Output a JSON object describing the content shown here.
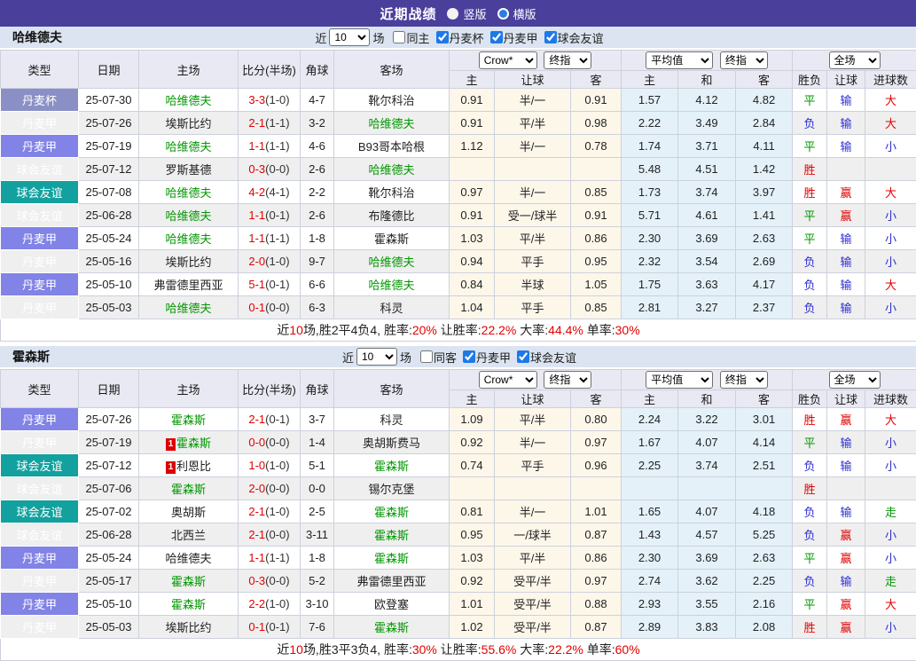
{
  "header": {
    "title": "近期战绩",
    "vertical_label": "竖版",
    "horizontal_label": "横版",
    "selected_layout": "横版"
  },
  "columns": {
    "type": "类型",
    "date": "日期",
    "home": "主场",
    "score": "比分(半场)",
    "corner": "角球",
    "away": "客场",
    "sub": [
      "主",
      "让球",
      "客",
      "主",
      "和",
      "客",
      "胜负",
      "让球",
      "进球数"
    ]
  },
  "controls": {
    "crow_select": "Crow*",
    "final_select": "终指",
    "avg_select": "平均值",
    "final_select_2": "终指",
    "scope_select": "全场"
  },
  "colors": {
    "titlebar": "#4b3f9c",
    "badge_cup": "#8a90c6",
    "badge_league": "#8183e6",
    "badge_friendly": "#12a19e",
    "odds_bg": "#fdf7ea",
    "avg_bg": "#e4f1f9",
    "win_red": "#e30000",
    "draw_green": "#009700",
    "lose_blue": "#2d2dd2"
  },
  "sections": [
    {
      "team": "哈维德夫",
      "filter": {
        "near_label": "近",
        "count": "10",
        "games_label": "场",
        "same": {
          "label": "同主",
          "checked": false
        },
        "leagues": [
          {
            "label": "丹麦杯",
            "checked": true
          },
          {
            "label": "丹麦甲",
            "checked": true
          },
          {
            "label": "球会友谊",
            "checked": true
          }
        ]
      },
      "rows": [
        {
          "league": "丹麦杯",
          "kind": "cup",
          "date": "25-07-30",
          "home": "哈维德夫",
          "home_green": true,
          "home_redcard": "",
          "score": "3-3",
          "half": "(1-0)",
          "corner": "4-7",
          "away": "靴尔科治",
          "away_green": false,
          "away_redcard": "",
          "odds": [
            "0.91",
            "半/一",
            "0.91"
          ],
          "avg": [
            "1.57",
            "4.12",
            "4.82"
          ],
          "results": [
            {
              "text": "平",
              "color": "green"
            },
            {
              "text": "输",
              "color": "blue"
            },
            {
              "text": "大",
              "color": "red"
            }
          ]
        },
        {
          "league": "丹麦甲",
          "kind": "league",
          "date": "25-07-26",
          "home": "埃斯比约",
          "home_green": false,
          "home_redcard": "",
          "score": "2-1",
          "half": "(1-1)",
          "corner": "3-2",
          "away": "哈维德夫",
          "away_green": true,
          "away_redcard": "",
          "odds": [
            "0.91",
            "平/半",
            "0.98"
          ],
          "avg": [
            "2.22",
            "3.49",
            "2.84"
          ],
          "results": [
            {
              "text": "负",
              "color": "blue"
            },
            {
              "text": "输",
              "color": "blue"
            },
            {
              "text": "大",
              "color": "red"
            }
          ]
        },
        {
          "league": "丹麦甲",
          "kind": "league",
          "date": "25-07-19",
          "home": "哈维德夫",
          "home_green": true,
          "home_redcard": "",
          "score": "1-1",
          "half": "(1-1)",
          "corner": "4-6",
          "away": "B93哥本哈根",
          "away_green": false,
          "away_redcard": "",
          "odds": [
            "1.12",
            "半/一",
            "0.78"
          ],
          "avg": [
            "1.74",
            "3.71",
            "4.11"
          ],
          "results": [
            {
              "text": "平",
              "color": "green"
            },
            {
              "text": "输",
              "color": "blue"
            },
            {
              "text": "小",
              "color": "blue"
            }
          ]
        },
        {
          "league": "球会友谊",
          "kind": "friendly",
          "date": "25-07-12",
          "home": "罗斯基德",
          "home_green": false,
          "home_redcard": "",
          "score": "0-3",
          "half": "(0-0)",
          "corner": "2-6",
          "away": "哈维德夫",
          "away_green": true,
          "away_redcard": "",
          "odds": [
            "",
            "",
            ""
          ],
          "avg": [
            "5.48",
            "4.51",
            "1.42"
          ],
          "results": [
            {
              "text": "胜",
              "color": "red"
            },
            {
              "text": "",
              "color": ""
            },
            {
              "text": "",
              "color": ""
            }
          ]
        },
        {
          "league": "球会友谊",
          "kind": "friendly",
          "date": "25-07-08",
          "home": "哈维德夫",
          "home_green": true,
          "home_redcard": "",
          "score": "4-2",
          "half": "(4-1)",
          "corner": "2-2",
          "away": "靴尔科治",
          "away_green": false,
          "away_redcard": "",
          "odds": [
            "0.97",
            "半/一",
            "0.85"
          ],
          "avg": [
            "1.73",
            "3.74",
            "3.97"
          ],
          "results": [
            {
              "text": "胜",
              "color": "red"
            },
            {
              "text": "赢",
              "color": "red"
            },
            {
              "text": "大",
              "color": "red"
            }
          ]
        },
        {
          "league": "球会友谊",
          "kind": "friendly",
          "date": "25-06-28",
          "home": "哈维德夫",
          "home_green": true,
          "home_redcard": "",
          "score": "1-1",
          "half": "(0-1)",
          "corner": "2-6",
          "away": "布隆德比",
          "away_green": false,
          "away_redcard": "",
          "odds": [
            "0.91",
            "受一/球半",
            "0.91"
          ],
          "avg": [
            "5.71",
            "4.61",
            "1.41"
          ],
          "results": [
            {
              "text": "平",
              "color": "green"
            },
            {
              "text": "赢",
              "color": "red"
            },
            {
              "text": "小",
              "color": "blue"
            }
          ]
        },
        {
          "league": "丹麦甲",
          "kind": "league",
          "date": "25-05-24",
          "home": "哈维德夫",
          "home_green": true,
          "home_redcard": "",
          "score": "1-1",
          "half": "(1-1)",
          "corner": "1-8",
          "away": "霍森斯",
          "away_green": false,
          "away_redcard": "",
          "odds": [
            "1.03",
            "平/半",
            "0.86"
          ],
          "avg": [
            "2.30",
            "3.69",
            "2.63"
          ],
          "results": [
            {
              "text": "平",
              "color": "green"
            },
            {
              "text": "输",
              "color": "blue"
            },
            {
              "text": "小",
              "color": "blue"
            }
          ]
        },
        {
          "league": "丹麦甲",
          "kind": "league",
          "date": "25-05-16",
          "home": "埃斯比约",
          "home_green": false,
          "home_redcard": "",
          "score": "2-0",
          "half": "(1-0)",
          "corner": "9-7",
          "away": "哈维德夫",
          "away_green": true,
          "away_redcard": "",
          "odds": [
            "0.94",
            "平手",
            "0.95"
          ],
          "avg": [
            "2.32",
            "3.54",
            "2.69"
          ],
          "results": [
            {
              "text": "负",
              "color": "blue"
            },
            {
              "text": "输",
              "color": "blue"
            },
            {
              "text": "小",
              "color": "blue"
            }
          ]
        },
        {
          "league": "丹麦甲",
          "kind": "league",
          "date": "25-05-10",
          "home": "弗雷德里西亚",
          "home_green": false,
          "home_redcard": "",
          "score": "5-1",
          "half": "(0-1)",
          "corner": "6-6",
          "away": "哈维德夫",
          "away_green": true,
          "away_redcard": "",
          "odds": [
            "0.84",
            "半球",
            "1.05"
          ],
          "avg": [
            "1.75",
            "3.63",
            "4.17"
          ],
          "results": [
            {
              "text": "负",
              "color": "blue"
            },
            {
              "text": "输",
              "color": "blue"
            },
            {
              "text": "大",
              "color": "red"
            }
          ]
        },
        {
          "league": "丹麦甲",
          "kind": "league",
          "date": "25-05-03",
          "home": "哈维德夫",
          "home_green": true,
          "home_redcard": "",
          "score": "0-1",
          "half": "(0-0)",
          "corner": "6-3",
          "away": "科灵",
          "away_green": false,
          "away_redcard": "",
          "odds": [
            "1.04",
            "平手",
            "0.85"
          ],
          "avg": [
            "2.81",
            "3.27",
            "2.37"
          ],
          "results": [
            {
              "text": "负",
              "color": "blue"
            },
            {
              "text": "输",
              "color": "blue"
            },
            {
              "text": "小",
              "color": "blue"
            }
          ]
        }
      ],
      "summary": [
        {
          "text": "近",
          "red": false
        },
        {
          "text": "10",
          "red": true
        },
        {
          "text": "场,胜2平4负4, 胜率:",
          "red": false
        },
        {
          "text": "20%",
          "red": true
        },
        {
          "text": " 让胜率:",
          "red": false
        },
        {
          "text": "22.2%",
          "red": true
        },
        {
          "text": " 大率:",
          "red": false
        },
        {
          "text": "44.4%",
          "red": true
        },
        {
          "text": " 单率:",
          "red": false
        },
        {
          "text": "30%",
          "red": true
        }
      ]
    },
    {
      "team": "霍森斯",
      "filter": {
        "near_label": "近",
        "count": "10",
        "games_label": "场",
        "same": {
          "label": "同客",
          "checked": false
        },
        "leagues": [
          {
            "label": "丹麦甲",
            "checked": true
          },
          {
            "label": "球会友谊",
            "checked": true
          }
        ]
      },
      "rows": [
        {
          "league": "丹麦甲",
          "kind": "league",
          "date": "25-07-26",
          "home": "霍森斯",
          "home_green": true,
          "home_redcard": "",
          "score": "2-1",
          "half": "(0-1)",
          "corner": "3-7",
          "away": "科灵",
          "away_green": false,
          "away_redcard": "",
          "odds": [
            "1.09",
            "平/半",
            "0.80"
          ],
          "avg": [
            "2.24",
            "3.22",
            "3.01"
          ],
          "results": [
            {
              "text": "胜",
              "color": "red"
            },
            {
              "text": "赢",
              "color": "red"
            },
            {
              "text": "大",
              "color": "red"
            }
          ]
        },
        {
          "league": "丹麦甲",
          "kind": "league",
          "date": "25-07-19",
          "home": "霍森斯",
          "home_green": true,
          "home_redcard": "1",
          "score": "0-0",
          "half": "(0-0)",
          "corner": "1-4",
          "away": "奥胡斯费马",
          "away_green": false,
          "away_redcard": "",
          "odds": [
            "0.92",
            "半/一",
            "0.97"
          ],
          "avg": [
            "1.67",
            "4.07",
            "4.14"
          ],
          "results": [
            {
              "text": "平",
              "color": "green"
            },
            {
              "text": "输",
              "color": "blue"
            },
            {
              "text": "小",
              "color": "blue"
            }
          ]
        },
        {
          "league": "球会友谊",
          "kind": "friendly",
          "date": "25-07-12",
          "home": "利恩比",
          "home_green": false,
          "home_redcard": "1",
          "score": "1-0",
          "half": "(1-0)",
          "corner": "5-1",
          "away": "霍森斯",
          "away_green": true,
          "away_redcard": "",
          "odds": [
            "0.74",
            "平手",
            "0.96"
          ],
          "avg": [
            "2.25",
            "3.74",
            "2.51"
          ],
          "results": [
            {
              "text": "负",
              "color": "blue"
            },
            {
              "text": "输",
              "color": "blue"
            },
            {
              "text": "小",
              "color": "blue"
            }
          ]
        },
        {
          "league": "球会友谊",
          "kind": "friendly",
          "date": "25-07-06",
          "home": "霍森斯",
          "home_green": true,
          "home_redcard": "",
          "score": "2-0",
          "half": "(0-0)",
          "corner": "0-0",
          "away": "锡尔克堡",
          "away_green": false,
          "away_redcard": "",
          "odds": [
            "",
            "",
            ""
          ],
          "avg": [
            "",
            "",
            ""
          ],
          "results": [
            {
              "text": "胜",
              "color": "red"
            },
            {
              "text": "",
              "color": ""
            },
            {
              "text": "",
              "color": ""
            }
          ]
        },
        {
          "league": "球会友谊",
          "kind": "friendly",
          "date": "25-07-02",
          "home": "奥胡斯",
          "home_green": false,
          "home_redcard": "",
          "score": "2-1",
          "half": "(1-0)",
          "corner": "2-5",
          "away": "霍森斯",
          "away_green": true,
          "away_redcard": "",
          "odds": [
            "0.81",
            "半/一",
            "1.01"
          ],
          "avg": [
            "1.65",
            "4.07",
            "4.18"
          ],
          "results": [
            {
              "text": "负",
              "color": "blue"
            },
            {
              "text": "输",
              "color": "blue"
            },
            {
              "text": "走",
              "color": "green"
            }
          ]
        },
        {
          "league": "球会友谊",
          "kind": "friendly",
          "date": "25-06-28",
          "home": "北西兰",
          "home_green": false,
          "home_redcard": "",
          "score": "2-1",
          "half": "(0-0)",
          "corner": "3-11",
          "away": "霍森斯",
          "away_green": true,
          "away_redcard": "",
          "odds": [
            "0.95",
            "一/球半",
            "0.87"
          ],
          "avg": [
            "1.43",
            "4.57",
            "5.25"
          ],
          "results": [
            {
              "text": "负",
              "color": "blue"
            },
            {
              "text": "赢",
              "color": "red"
            },
            {
              "text": "小",
              "color": "blue"
            }
          ]
        },
        {
          "league": "丹麦甲",
          "kind": "league",
          "date": "25-05-24",
          "home": "哈维德夫",
          "home_green": false,
          "home_redcard": "",
          "score": "1-1",
          "half": "(1-1)",
          "corner": "1-8",
          "away": "霍森斯",
          "away_green": true,
          "away_redcard": "",
          "odds": [
            "1.03",
            "平/半",
            "0.86"
          ],
          "avg": [
            "2.30",
            "3.69",
            "2.63"
          ],
          "results": [
            {
              "text": "平",
              "color": "green"
            },
            {
              "text": "赢",
              "color": "red"
            },
            {
              "text": "小",
              "color": "blue"
            }
          ]
        },
        {
          "league": "丹麦甲",
          "kind": "league",
          "date": "25-05-17",
          "home": "霍森斯",
          "home_green": true,
          "home_redcard": "",
          "score": "0-3",
          "half": "(0-0)",
          "corner": "5-2",
          "away": "弗雷德里西亚",
          "away_green": false,
          "away_redcard": "",
          "odds": [
            "0.92",
            "受平/半",
            "0.97"
          ],
          "avg": [
            "2.74",
            "3.62",
            "2.25"
          ],
          "results": [
            {
              "text": "负",
              "color": "blue"
            },
            {
              "text": "输",
              "color": "blue"
            },
            {
              "text": "走",
              "color": "green"
            }
          ]
        },
        {
          "league": "丹麦甲",
          "kind": "league",
          "date": "25-05-10",
          "home": "霍森斯",
          "home_green": true,
          "home_redcard": "",
          "score": "2-2",
          "half": "(1-0)",
          "corner": "3-10",
          "away": "欧登塞",
          "away_green": false,
          "away_redcard": "",
          "odds": [
            "1.01",
            "受平/半",
            "0.88"
          ],
          "avg": [
            "2.93",
            "3.55",
            "2.16"
          ],
          "results": [
            {
              "text": "平",
              "color": "green"
            },
            {
              "text": "赢",
              "color": "red"
            },
            {
              "text": "大",
              "color": "red"
            }
          ]
        },
        {
          "league": "丹麦甲",
          "kind": "league",
          "date": "25-05-03",
          "home": "埃斯比约",
          "home_green": false,
          "home_redcard": "",
          "score": "0-1",
          "half": "(0-1)",
          "corner": "7-6",
          "away": "霍森斯",
          "away_green": true,
          "away_redcard": "",
          "odds": [
            "1.02",
            "受平/半",
            "0.87"
          ],
          "avg": [
            "2.89",
            "3.83",
            "2.08"
          ],
          "results": [
            {
              "text": "胜",
              "color": "red"
            },
            {
              "text": "赢",
              "color": "red"
            },
            {
              "text": "小",
              "color": "blue"
            }
          ]
        }
      ],
      "summary": [
        {
          "text": "近",
          "red": false
        },
        {
          "text": "10",
          "red": true
        },
        {
          "text": "场,胜3平3负4, 胜率:",
          "red": false
        },
        {
          "text": "30%",
          "red": true
        },
        {
          "text": " 让胜率:",
          "red": false
        },
        {
          "text": "55.6%",
          "red": true
        },
        {
          "text": " 大率:",
          "red": false
        },
        {
          "text": "22.2%",
          "red": true
        },
        {
          "text": " 单率:",
          "red": false
        },
        {
          "text": "60%",
          "red": true
        }
      ]
    }
  ]
}
